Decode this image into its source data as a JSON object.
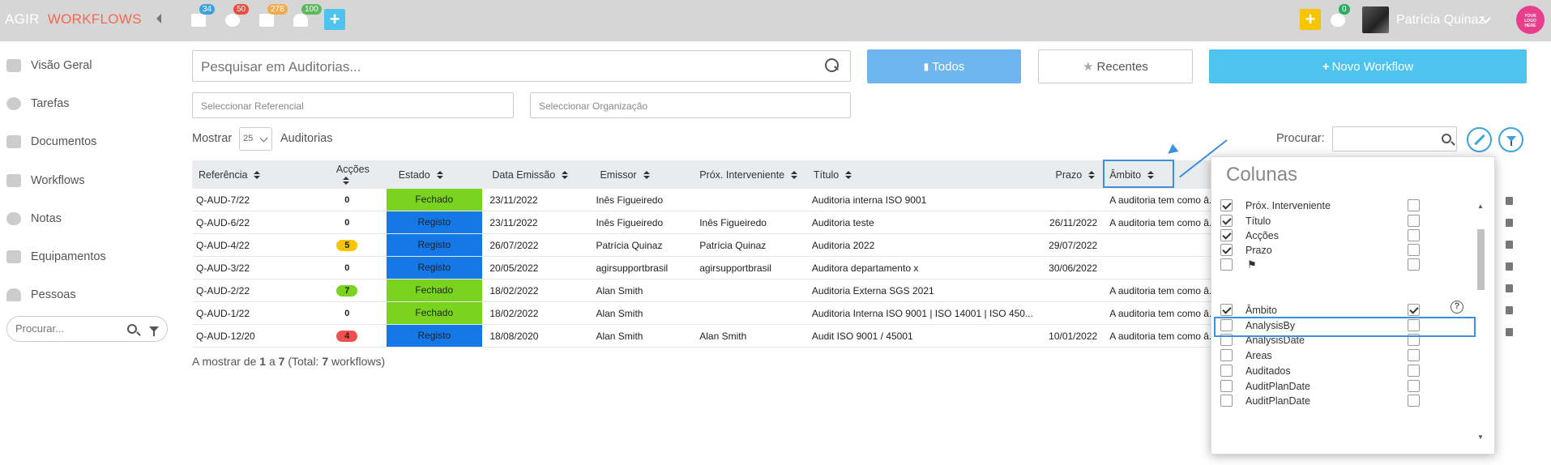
{
  "topbar": {
    "brand_a": "AGIR",
    "brand_b": "WORKFLOWS",
    "badges": [
      {
        "icon": "calendar-icon",
        "count": "34",
        "color": "#3ea2dd"
      },
      {
        "icon": "gear-icon",
        "count": "50",
        "color": "#e74c3c"
      },
      {
        "icon": "document-icon",
        "count": "278",
        "color": "#f0ad4e"
      },
      {
        "icon": "bell-icon",
        "count": "100",
        "color": "#5cb85c"
      }
    ],
    "plus_label": "+",
    "yellow_plus": "+",
    "cloud_badge": "0",
    "user_name": "Patrícia Quinaz",
    "logo_text": "YOUR LOGO HERE"
  },
  "sidebar": {
    "items": [
      {
        "label": "Visão Geral",
        "icon": "home-icon"
      },
      {
        "label": "Tarefas",
        "icon": "gear-icon"
      },
      {
        "label": "Documentos",
        "icon": "document-icon"
      },
      {
        "label": "Workflows",
        "icon": "workflows-icon"
      },
      {
        "label": "Notas",
        "icon": "comments-icon"
      },
      {
        "label": "Equipamentos",
        "icon": "wrench-icon"
      },
      {
        "label": "Pessoas",
        "icon": "user-icon"
      }
    ],
    "search_placeholder": "Procurar..."
  },
  "main": {
    "search_placeholder": "Pesquisar em Auditorias...",
    "btn_todos": "Todos",
    "btn_recentes": "Recentes",
    "btn_novo": "Novo Workflow",
    "select_referencial": "Seleccionar Referencial",
    "select_organizacao": "Seleccionar Organização",
    "mostrar": "Mostrar",
    "per_page": "25",
    "auditorias": "Auditorias",
    "procurar": "Procurar:",
    "colors": {
      "btn_todos": "#6fb6f0",
      "btn_novo": "#4fc3f0",
      "fechado": "#7ad31f",
      "registo": "#1478e6"
    }
  },
  "table": {
    "headers": [
      "Referência",
      "Acções",
      "Estado",
      "Data Emissão",
      "Emissor",
      "Próx. Interveniente",
      "Título",
      "Prazo",
      "Âmbito"
    ],
    "rows": [
      {
        "ref": "Q-AUD-7/22",
        "accoes": "0",
        "accoes_color": "#ffffff",
        "estado": "Fechado",
        "estado_kind": "fechado",
        "data": "23/11/2022",
        "emissor": "Inês Figueiredo",
        "prox": "",
        "titulo": "Auditoria interna ISO 9001",
        "prazo": "",
        "ambito": "A auditoria tem como â..."
      },
      {
        "ref": "Q-AUD-6/22",
        "accoes": "0",
        "accoes_color": "#ffffff",
        "estado": "Registo",
        "estado_kind": "registo",
        "data": "23/11/2022",
        "emissor": "Inês Figueiredo",
        "prox": "Inês Figueiredo",
        "titulo": "Auditoria teste",
        "prazo": "26/11/2022",
        "ambito": "A auditoria tem como â..."
      },
      {
        "ref": "Q-AUD-4/22",
        "accoes": "5",
        "accoes_color": "#f7c500",
        "estado": "Registo",
        "estado_kind": "registo",
        "data": "26/07/2022",
        "emissor": "Patrícia Quinaz",
        "prox": "Patrícia Quinaz",
        "titulo": "Auditoria 2022",
        "prazo": "29/07/2022",
        "ambito": ""
      },
      {
        "ref": "Q-AUD-3/22",
        "accoes": "0",
        "accoes_color": "#ffffff",
        "estado": "Registo",
        "estado_kind": "registo",
        "data": "20/05/2022",
        "emissor": "agirsupportbrasil",
        "prox": "agirsupportbrasil",
        "titulo": "Auditora departamento x",
        "prazo": "30/06/2022",
        "ambito": ""
      },
      {
        "ref": "Q-AUD-2/22",
        "accoes": "7",
        "accoes_color": "#7ad31f",
        "estado": "Fechado",
        "estado_kind": "fechado",
        "data": "18/02/2022",
        "emissor": "Alan Smith",
        "prox": "",
        "titulo": "Auditoria Externa SGS 2021",
        "prazo": "",
        "ambito": "A auditoria tem como â..."
      },
      {
        "ref": "Q-AUD-1/22",
        "accoes": "0",
        "accoes_color": "#ffffff",
        "estado": "Fechado",
        "estado_kind": "fechado",
        "data": "18/02/2022",
        "emissor": "Alan Smith",
        "prox": "",
        "titulo": "Auditoria Interna ISO 9001 | ISO 14001 | ISO 450...",
        "prazo": "",
        "ambito": "A auditoria tem como â..."
      },
      {
        "ref": "Q-AUD-12/20",
        "accoes": "4",
        "accoes_color": "#f05050",
        "estado": "Registo",
        "estado_kind": "registo",
        "data": "18/08/2020",
        "emissor": "Alan Smith",
        "prox": "Alan Smith",
        "titulo": "Audit ISO 9001 / 45001",
        "prazo": "10/01/2022",
        "ambito": "A auditoria tem como â..."
      }
    ],
    "footer": {
      "a": "A mostrar de ",
      "from": "1",
      "b": " a ",
      "to": "7",
      "c": " (Total: ",
      "total": "7",
      "d": " workflows)"
    }
  },
  "colunas": {
    "title": "Colunas",
    "items": [
      {
        "label": "Próx. Interveniente",
        "checked": true,
        "right": false
      },
      {
        "label": "Título",
        "checked": true,
        "right": false
      },
      {
        "label": "Acções",
        "checked": true,
        "right": false
      },
      {
        "label": "Prazo",
        "checked": true,
        "right": false
      },
      {
        "label": "",
        "checked": false,
        "right": false,
        "flag": true
      },
      {
        "label": "Âmbito",
        "checked": true,
        "right": true
      },
      {
        "label": "AnalysisBy",
        "checked": false,
        "right": false
      },
      {
        "label": "AnalysisDate",
        "checked": false,
        "right": false
      },
      {
        "label": "Areas",
        "checked": false,
        "right": false
      },
      {
        "label": "Auditados",
        "checked": false,
        "right": false
      },
      {
        "label": "AuditPlanDate",
        "checked": false,
        "right": false
      },
      {
        "label": "AuditPlanDate",
        "checked": false,
        "right": false
      }
    ]
  }
}
